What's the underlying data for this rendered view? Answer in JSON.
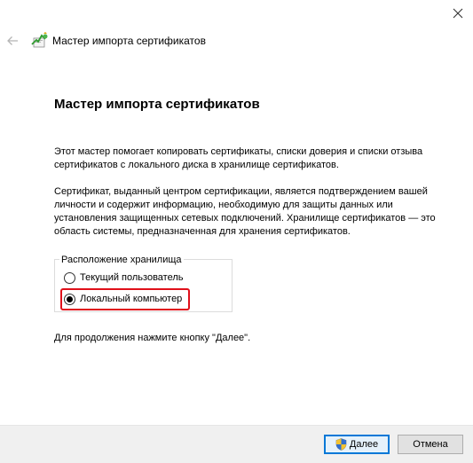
{
  "window": {
    "title": "Мастер импорта сертификатов"
  },
  "wizard": {
    "heading": "Мастер импорта сертификатов",
    "paragraph1": "Этот мастер помогает копировать сертификаты, списки доверия и списки отзыва сертификатов с локального диска в хранилище сертификатов.",
    "paragraph2": "Сертификат, выданный центром сертификации, является подтверждением вашей личности и содержит информацию, необходимую для защиты данных или установления защищенных сетевых подключений. Хранилище сертификатов — это область системы, предназначенная для хранения сертификатов.",
    "store_location": {
      "legend": "Расположение хранилища",
      "options": [
        {
          "label": "Текущий пользователь",
          "selected": false
        },
        {
          "label": "Локальный компьютер",
          "selected": true
        }
      ]
    },
    "continue_hint": "Для продолжения нажмите кнопку \"Далее\"."
  },
  "buttons": {
    "next": "Далее",
    "cancel": "Отмена"
  },
  "icons": {
    "close": "close-icon",
    "back": "back-arrow-icon",
    "wizard": "certificate-wizard-icon",
    "shield": "uac-shield-icon"
  },
  "colors": {
    "highlight": "#e0101a",
    "default_button_border": "#0078d7",
    "footer_bg": "#f0f0f0"
  }
}
